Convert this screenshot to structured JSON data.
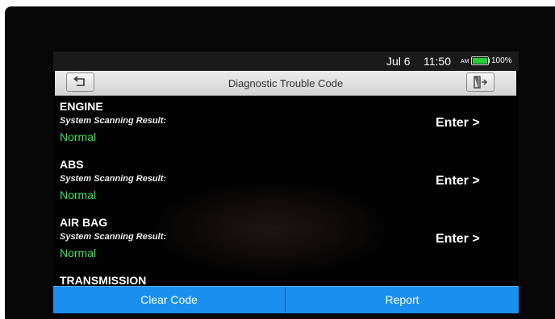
{
  "status": {
    "date": "Jul 6",
    "time": "11:50",
    "ampm": "AM",
    "battery_level": 1.0,
    "battery_pct": "100%",
    "battery_color": "#27d03a"
  },
  "header": {
    "title": "Diagnostic Trouble Code",
    "back_icon": "back-arrow-icon",
    "exit_icon": "exit-icon"
  },
  "systems": [
    {
      "name": "ENGINE",
      "label": "System Scanning Result:",
      "result": "Normal",
      "action": "Enter >"
    },
    {
      "name": "ABS",
      "label": "System Scanning Result:",
      "result": "Normal",
      "action": "Enter >"
    },
    {
      "name": "AIR BAG",
      "label": "System Scanning Result:",
      "result": "Normal",
      "action": "Enter >"
    },
    {
      "name": "TRANSMISSION"
    }
  ],
  "actions": {
    "clear": "Clear Code",
    "report": "Report"
  },
  "colors": {
    "accent": "#1a8ff0",
    "normal": "#3ee05a"
  }
}
